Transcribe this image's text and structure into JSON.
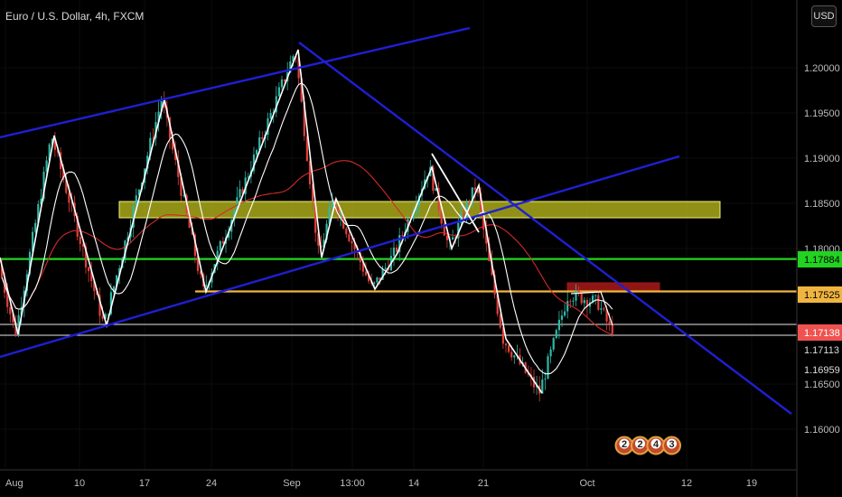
{
  "header": {
    "symbol_title": "Euro / U.S. Dollar, 4h, FXCM",
    "currency_button": "USD"
  },
  "colors": {
    "background": "#000000",
    "channel_line": "#1f1fd4",
    "zigzag": "#ffffff",
    "ma_fast": "#ffffff",
    "ma_slow": "#d42a2a",
    "candle_up": "#2fb8a6",
    "candle_down": "#e0403c",
    "zone_yellow": "#c8c81e",
    "line_green": "#22d322",
    "line_orange": "#f0b540",
    "zone_red": "#a01818",
    "price_badge_red": "#ef5350"
  },
  "chart_data": {
    "type": "candlestick",
    "symbol": "Euro / U.S. Dollar",
    "timeframe": "4h",
    "source": "FXCM",
    "ylim": [
      1.1555,
      1.2075
    ],
    "y_ticks": [
      {
        "label": "1.20000",
        "value": 1.2
      },
      {
        "label": "1.19500",
        "value": 1.195
      },
      {
        "label": "1.19000",
        "value": 1.19
      },
      {
        "label": "1.18500",
        "value": 1.185
      },
      {
        "label": "1.18000",
        "value": 1.18
      },
      {
        "label": "1.16500",
        "value": 1.165
      },
      {
        "label": "1.16000",
        "value": 1.16
      }
    ],
    "x_ticks": [
      "Aug",
      "10",
      "17",
      "24",
      "Sep",
      "13:00",
      "14",
      "21",
      "Oct",
      "12",
      "19"
    ],
    "price_labels": [
      {
        "label": "1.17884",
        "value": 1.17884,
        "style": "green"
      },
      {
        "label": "1.17525",
        "value": 1.17525,
        "style": "orange"
      },
      {
        "label": "1.17138",
        "value": 1.17138,
        "style": "red"
      },
      {
        "label": "1.17113",
        "value": 1.17113,
        "style": "plain"
      },
      {
        "label": "1.16959",
        "value": 1.16959,
        "style": "plain"
      }
    ],
    "horizontal_levels": [
      {
        "value": 1.17884,
        "color": "green"
      },
      {
        "value": 1.17525,
        "color": "orange"
      },
      {
        "value": 1.1716,
        "color": "white"
      },
      {
        "value": 1.1704,
        "color": "white"
      }
    ],
    "zones": [
      {
        "from": 1.1834,
        "to": 1.1852,
        "color": "yellow"
      },
      {
        "from": 1.1753,
        "to": 1.1762,
        "color": "red"
      }
    ],
    "price_path": [
      [
        0,
        1.179
      ],
      [
        20,
        1.1705
      ],
      [
        60,
        1.1925
      ],
      [
        118,
        1.1715
      ],
      [
        182,
        1.1965
      ],
      [
        228,
        1.1752
      ],
      [
        330,
        1.202
      ],
      [
        356,
        1.179
      ],
      [
        372,
        1.1855
      ],
      [
        415,
        1.1755
      ],
      [
        440,
        1.1795
      ],
      [
        478,
        1.189
      ],
      [
        500,
        1.18
      ],
      [
        530,
        1.187
      ],
      [
        545,
        1.178
      ],
      [
        560,
        1.17
      ],
      [
        600,
        1.164
      ],
      [
        632,
        1.175
      ],
      [
        665,
        1.174
      ],
      [
        678,
        1.1712
      ]
    ],
    "event_badges": [
      "2",
      "2",
      "4",
      "3"
    ]
  }
}
